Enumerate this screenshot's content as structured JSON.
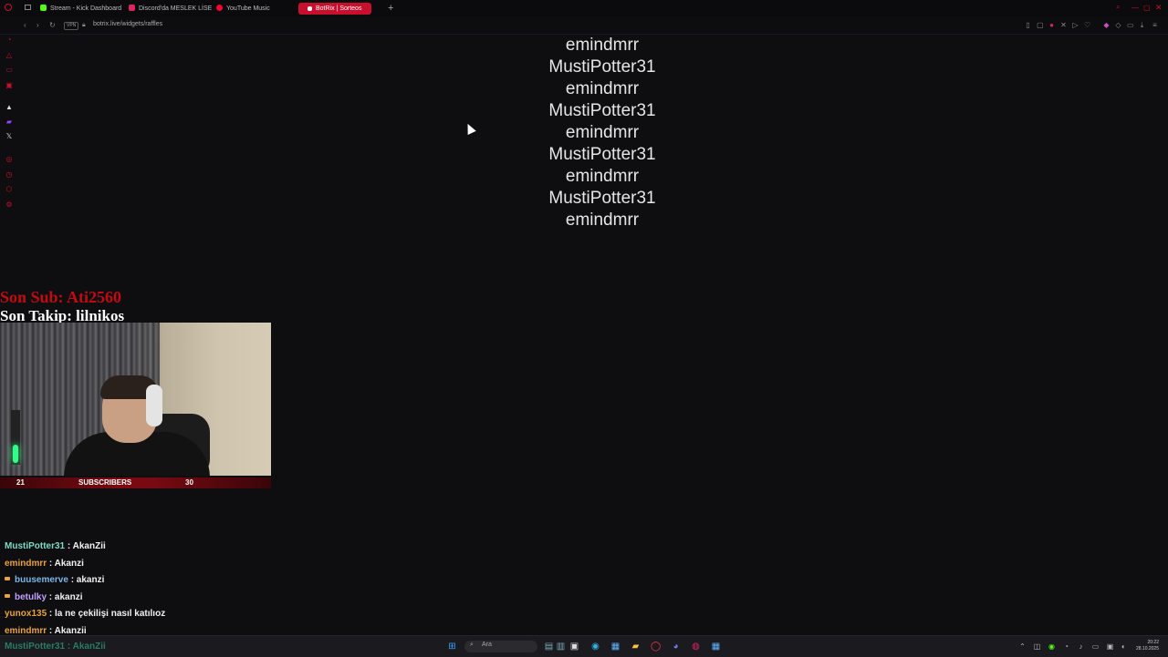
{
  "browser": {
    "tabs": [
      {
        "label": "Stream - Kick Dashboard",
        "color": "#53fc18"
      },
      {
        "label": "Discord'da MESLEK LİSE",
        "color": "#e0245e"
      },
      {
        "label": "YouTube Music",
        "color": "#ff0033"
      },
      {
        "label": "BotRix | Sorteos",
        "color": "#ffffff",
        "active": true
      }
    ],
    "new_tab": "+",
    "url": "botrix.live/widgets/raffles",
    "vpn_label": "VPN"
  },
  "raffle": {
    "entries": [
      "emindmrr",
      "MustiPotter31",
      "emindmrr",
      "MustiPotter31",
      "emindmrr",
      "MustiPotter31",
      "emindmrr",
      "MustiPotter31",
      "emindmrr"
    ]
  },
  "overlay": {
    "last_sub": "Son Sub: Ati2560",
    "last_follow": "Son Takip: lilnikos",
    "subbar": {
      "left": "21",
      "center": "SUBSCRIBERS",
      "right": "30"
    },
    "accent": "#c20a12"
  },
  "chat": {
    "messages": [
      {
        "user": "MustiPotter31",
        "color": "#7fd8c4",
        "badge": false,
        "text": ": AkanZii"
      },
      {
        "user": "emindmrr",
        "color": "#e8a33c",
        "badge": false,
        "text": ": Akanzi"
      },
      {
        "user": "buusemerve",
        "color": "#7ab7e8",
        "badge": true,
        "text": ": akanzi"
      },
      {
        "user": "betulky",
        "color": "#c3a0ff",
        "badge": true,
        "text": ": akanzi"
      },
      {
        "user": "yunox135",
        "color": "#e8a33c",
        "badge": false,
        "text": ": la ne çekilişi nasıl katılıoz"
      },
      {
        "user": "emindmrr",
        "color": "#e8a33c",
        "badge": false,
        "text": ": Akanzii"
      }
    ],
    "overlay_line": "MustiPotter31 : AkanZii"
  },
  "taskbar": {
    "search_placeholder": "Ara",
    "time": "20:22",
    "date": "28.10.2025"
  }
}
